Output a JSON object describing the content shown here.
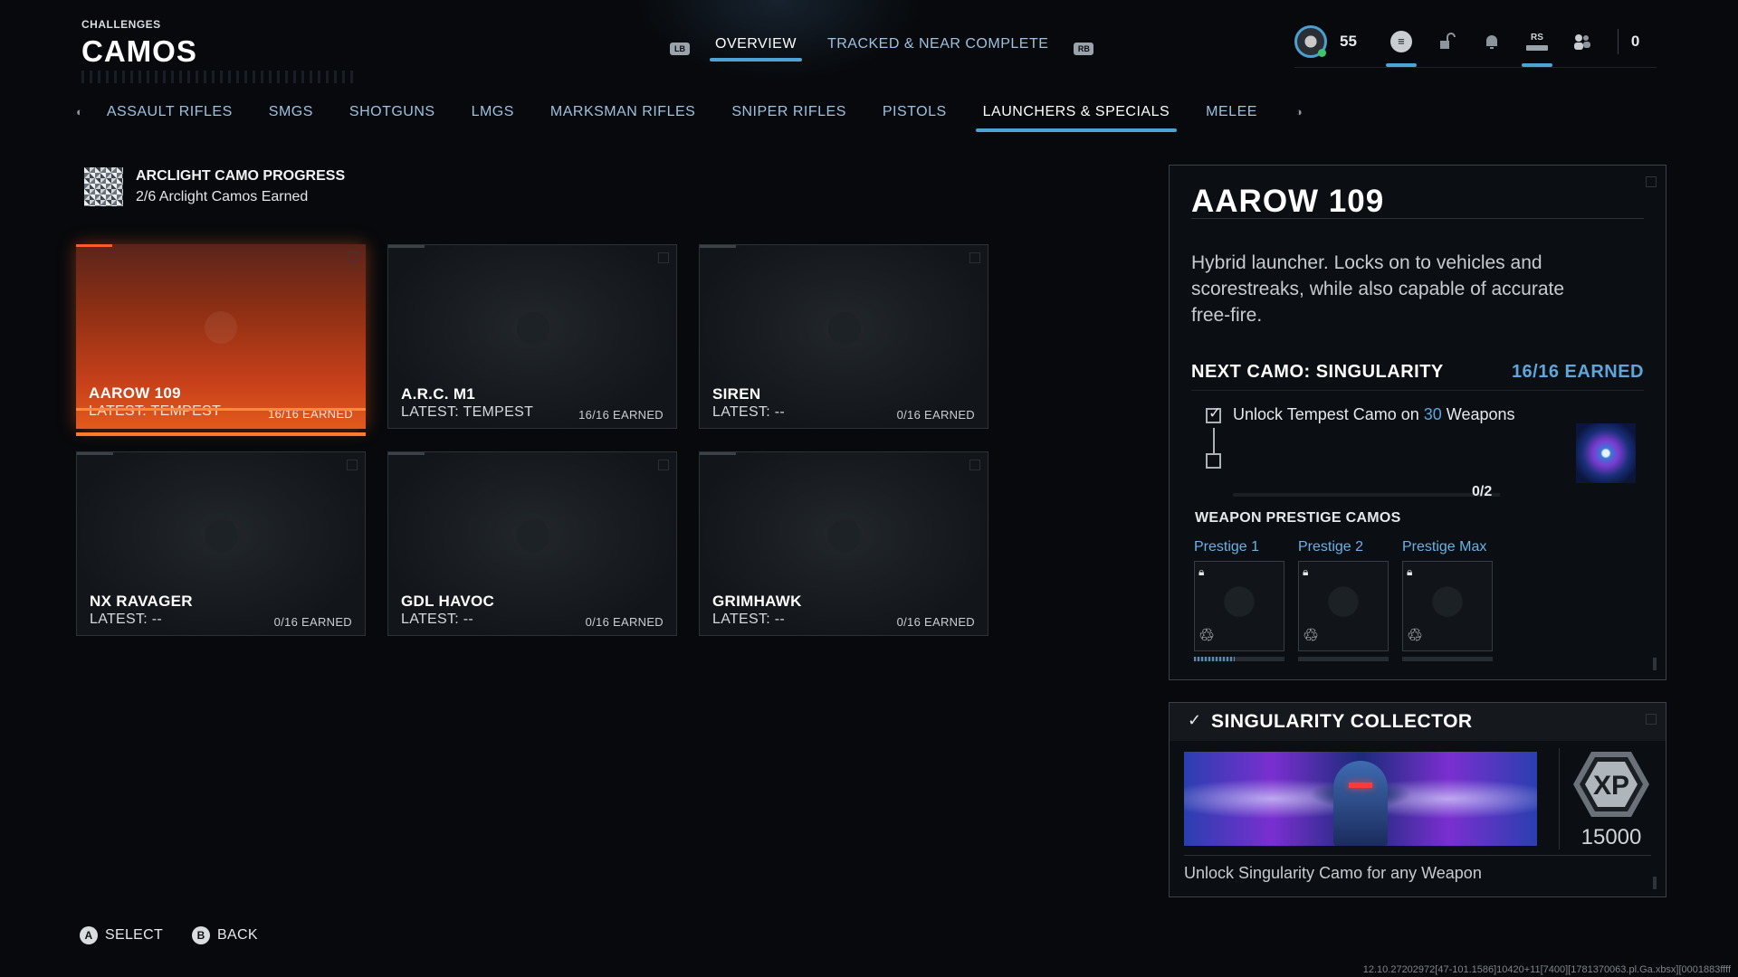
{
  "header": {
    "crumb": "CHALLENGES",
    "title": "CAMOS",
    "bumper_left": "LB",
    "bumper_right": "RB",
    "tabs": [
      {
        "label": "OVERVIEW",
        "active": true
      },
      {
        "label": "TRACKED & NEAR COMPLETE",
        "active": false
      }
    ],
    "level": "55",
    "rs_label": "RS",
    "count": "0"
  },
  "categories": {
    "items": [
      {
        "label": "ASSAULT RIFLES"
      },
      {
        "label": "SMGS"
      },
      {
        "label": "SHOTGUNS"
      },
      {
        "label": "LMGS"
      },
      {
        "label": "MARKSMAN RIFLES"
      },
      {
        "label": "SNIPER RIFLES"
      },
      {
        "label": "PISTOLS"
      },
      {
        "label": "LAUNCHERS & SPECIALS"
      },
      {
        "label": "MELEE"
      }
    ],
    "active_index": 7
  },
  "arclight": {
    "title": "ARCLIGHT CAMO PROGRESS",
    "subtitle": "2/6 Arclight Camos Earned"
  },
  "weapons": [
    {
      "name": "AAROW 109",
      "latest": "LATEST: TEMPEST",
      "earned": "16/16 EARNED"
    },
    {
      "name": "A.R.C. M1",
      "latest": "LATEST: TEMPEST",
      "earned": "16/16 EARNED"
    },
    {
      "name": "SIREN",
      "latest": "LATEST: --",
      "earned": "0/16 EARNED"
    },
    {
      "name": "NX RAVAGER",
      "latest": "LATEST: --",
      "earned": "0/16 EARNED"
    },
    {
      "name": "GDL HAVOC",
      "latest": "LATEST: --",
      "earned": "0/16 EARNED"
    },
    {
      "name": "GRIMHAWK",
      "latest": "LATEST: --",
      "earned": "0/16 EARNED"
    }
  ],
  "detail": {
    "title": "AAROW 109",
    "description": "Hybrid launcher. Locks on to vehicles and scorestreaks, while also capable of accurate free-fire.",
    "next_camo_label": "NEXT CAMO: SINGULARITY",
    "next_camo_earned": "16/16 EARNED",
    "task_prefix": "Unlock Tempest Camo on ",
    "task_number": "30",
    "task_suffix": " Weapons",
    "task_progress": "0/2",
    "prestige_label": "WEAPON PRESTIGE CAMOS",
    "prestige": [
      {
        "label": "Prestige 1",
        "progress": 0.45
      },
      {
        "label": "Prestige 2",
        "progress": 0
      },
      {
        "label": "Prestige Max",
        "progress": 0
      }
    ]
  },
  "collector": {
    "title": "SINGULARITY COLLECTOR",
    "xp_label": "XP",
    "xp": "15000",
    "description": "Unlock Singularity Camo for any Weapon"
  },
  "footer": {
    "select_key": "A",
    "select_label": "SELECT",
    "back_key": "B",
    "back_label": "BACK",
    "build": "12.10.27202972[47-101.1586]10420+11[7400][1781370063.pl.Ga.xbsx][0001883ffff"
  },
  "colors": {
    "accent": "#4ba3d6",
    "selected_card": "#e25a1b",
    "highlight_text": "#5fa6d8"
  }
}
